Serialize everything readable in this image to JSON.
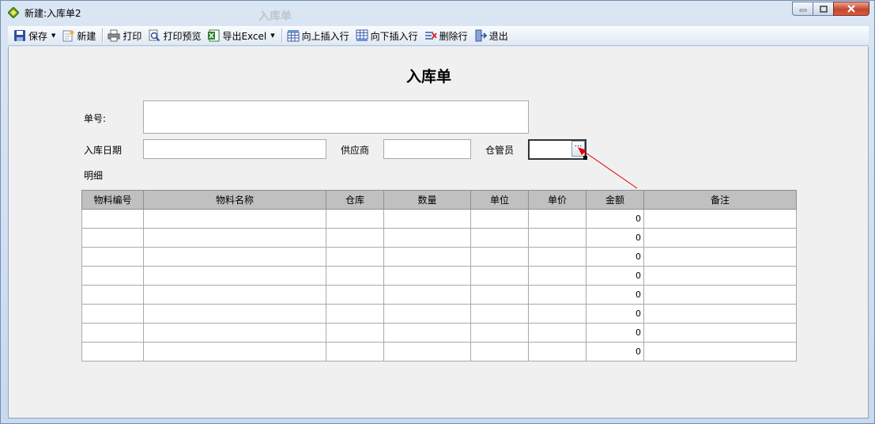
{
  "window": {
    "title": "新建:入库单2",
    "ghost_title": "入库单"
  },
  "toolbar": {
    "save": "保存",
    "new": "新建",
    "print": "打印",
    "print_preview": "打印预览",
    "export_excel": "导出Excel",
    "insert_above": "向上插入行",
    "insert_below": "向下插入行",
    "delete_row": "删除行",
    "exit": "退出"
  },
  "form": {
    "title": "入库单",
    "order_no_label": "单号:",
    "order_no_value": "",
    "date_label": "入库日期",
    "date_value": "",
    "supplier_label": "供应商",
    "supplier_value": "",
    "keeper_label": "仓管员",
    "keeper_value": "",
    "keeper_button": "···",
    "detail_label": "明细"
  },
  "table": {
    "columns": [
      "物料编号",
      "物料名称",
      "仓库",
      "数量",
      "单位",
      "单价",
      "金额",
      "备注"
    ],
    "rows": [
      [
        "",
        "",
        "",
        "",
        "",
        "",
        "0",
        ""
      ],
      [
        "",
        "",
        "",
        "",
        "",
        "",
        "0",
        ""
      ],
      [
        "",
        "",
        "",
        "",
        "",
        "",
        "0",
        ""
      ],
      [
        "",
        "",
        "",
        "",
        "",
        "",
        "0",
        ""
      ],
      [
        "",
        "",
        "",
        "",
        "",
        "",
        "0",
        ""
      ],
      [
        "",
        "",
        "",
        "",
        "",
        "",
        "0",
        ""
      ],
      [
        "",
        "",
        "",
        "",
        "",
        "",
        "0",
        ""
      ],
      [
        "",
        "",
        "",
        "",
        "",
        "",
        "0",
        ""
      ]
    ]
  },
  "colors": {
    "header_bg": "#c0c0c0",
    "client_bg": "#f0f0f0",
    "annotation": "#e00000"
  }
}
